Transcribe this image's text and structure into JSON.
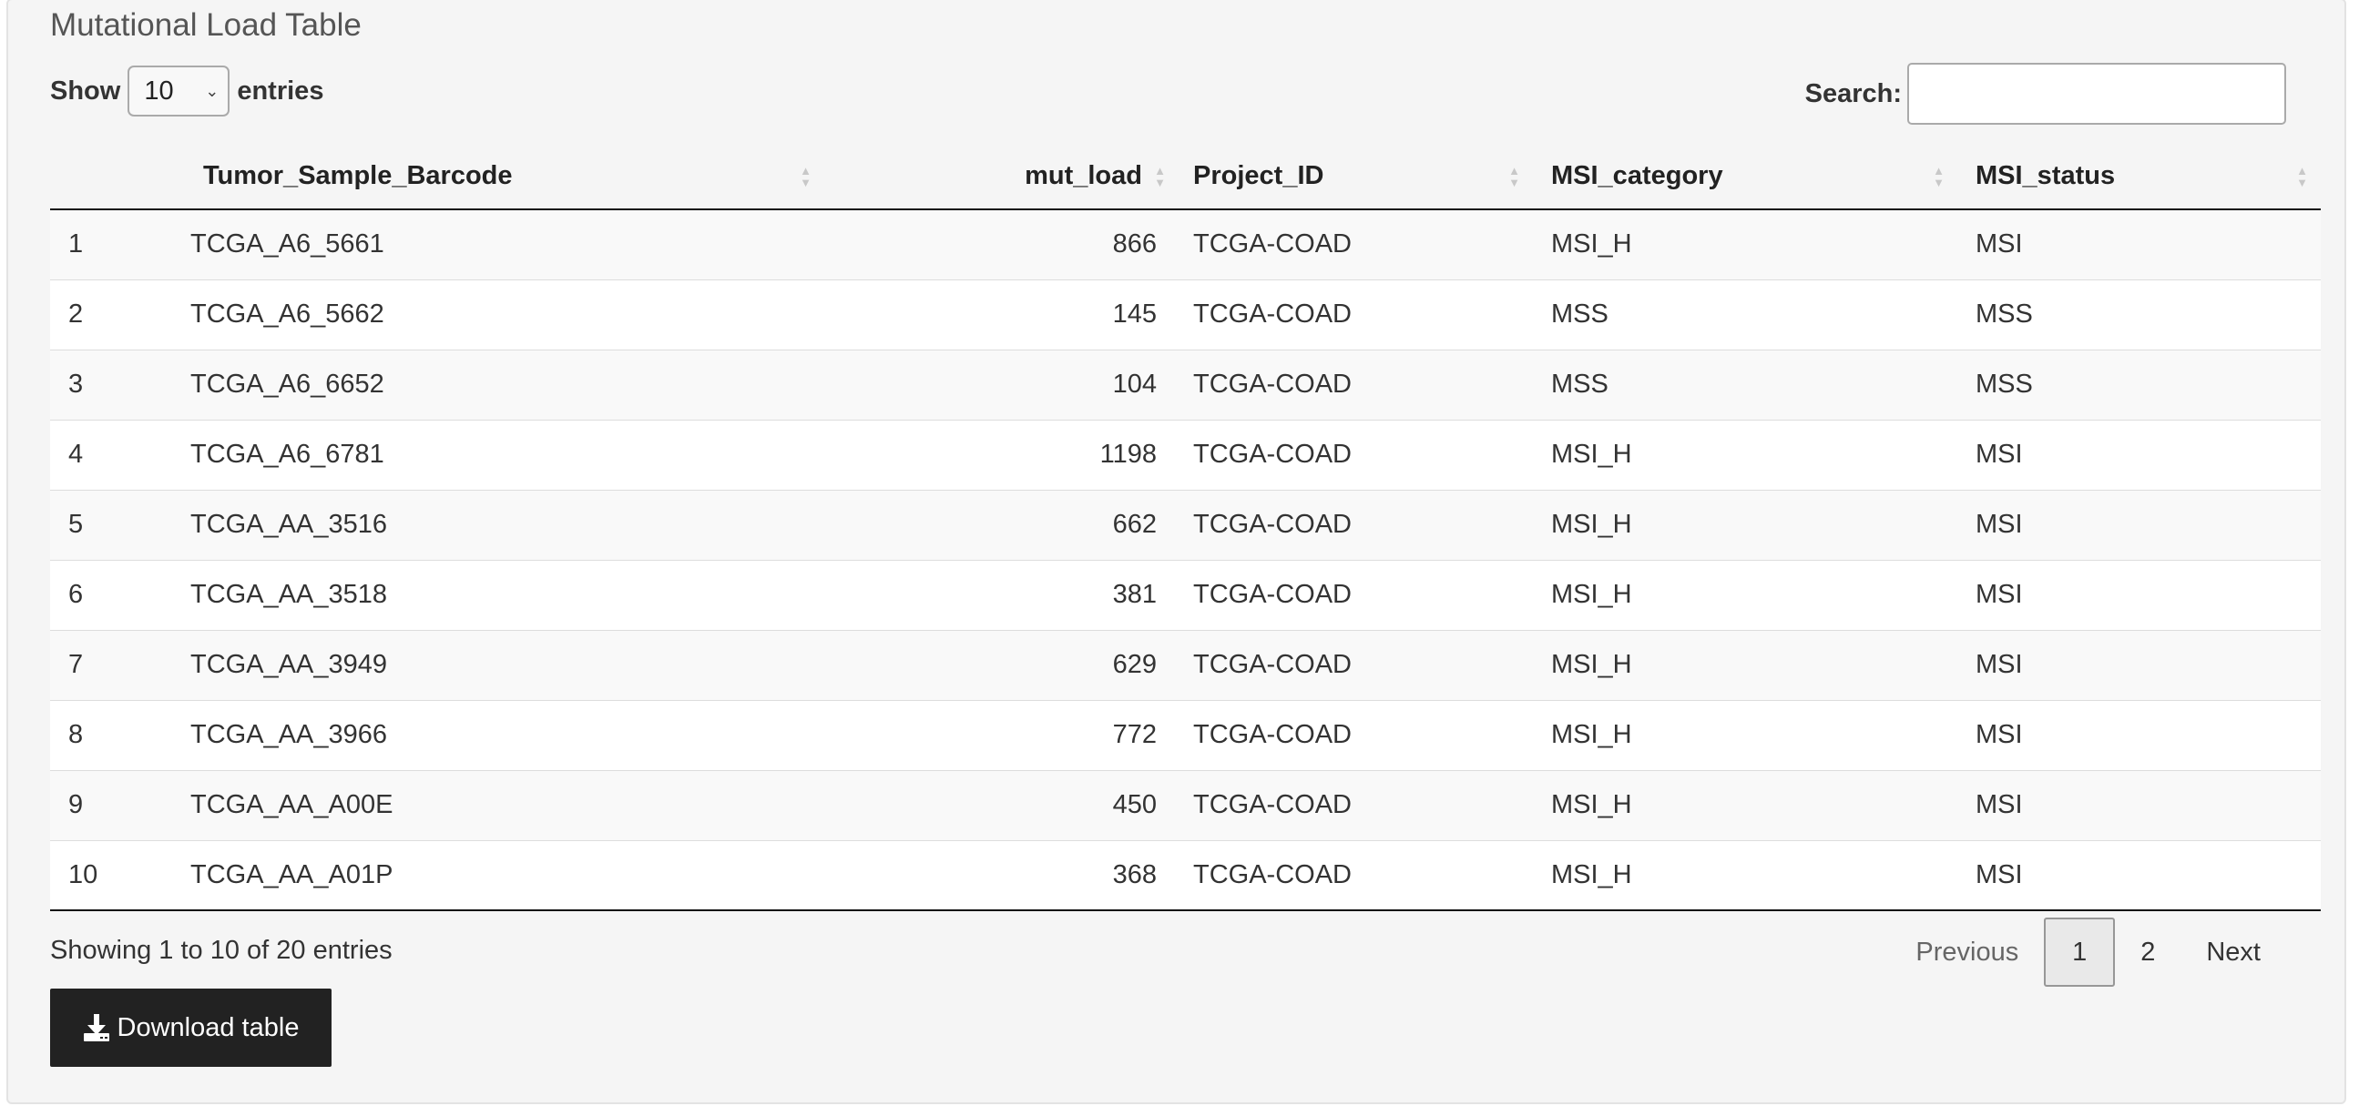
{
  "panel": {
    "title": "Mutational Load Table"
  },
  "length": {
    "show_label": "Show",
    "selected": "10",
    "entries_label": "entries"
  },
  "search": {
    "label": "Search:",
    "value": ""
  },
  "table": {
    "columns": [
      "",
      "Tumor_Sample_Barcode",
      "mut_load",
      "Project_ID",
      "MSI_category",
      "MSI_status"
    ],
    "rows": [
      [
        "1",
        "TCGA_A6_5661",
        "866",
        "TCGA-COAD",
        "MSI_H",
        "MSI"
      ],
      [
        "2",
        "TCGA_A6_5662",
        "145",
        "TCGA-COAD",
        "MSS",
        "MSS"
      ],
      [
        "3",
        "TCGA_A6_6652",
        "104",
        "TCGA-COAD",
        "MSS",
        "MSS"
      ],
      [
        "4",
        "TCGA_A6_6781",
        "1198",
        "TCGA-COAD",
        "MSI_H",
        "MSI"
      ],
      [
        "5",
        "TCGA_AA_3516",
        "662",
        "TCGA-COAD",
        "MSI_H",
        "MSI"
      ],
      [
        "6",
        "TCGA_AA_3518",
        "381",
        "TCGA-COAD",
        "MSI_H",
        "MSI"
      ],
      [
        "7",
        "TCGA_AA_3949",
        "629",
        "TCGA-COAD",
        "MSI_H",
        "MSI"
      ],
      [
        "8",
        "TCGA_AA_3966",
        "772",
        "TCGA-COAD",
        "MSI_H",
        "MSI"
      ],
      [
        "9",
        "TCGA_AA_A00E",
        "450",
        "TCGA-COAD",
        "MSI_H",
        "MSI"
      ],
      [
        "10",
        "TCGA_AA_A01P",
        "368",
        "TCGA-COAD",
        "MSI_H",
        "MSI"
      ]
    ]
  },
  "info": {
    "text": "Showing 1 to 10 of 20 entries"
  },
  "pagination": {
    "previous": "Previous",
    "pages": [
      "1",
      "2"
    ],
    "current": "1",
    "next": "Next"
  },
  "download": {
    "label": "Download table",
    "icon": "download-icon"
  },
  "colors": {
    "panel_bg": "#f5f5f5",
    "button_bg": "#222222",
    "row_odd": "#f9f9f9"
  }
}
